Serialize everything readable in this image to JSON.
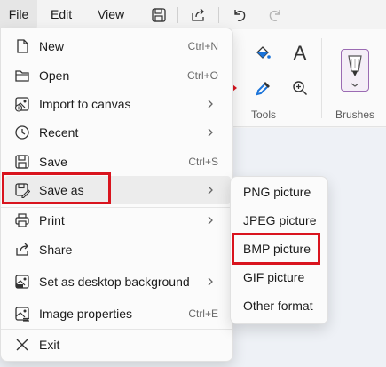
{
  "menubar": {
    "file": "File",
    "edit": "Edit",
    "view": "View"
  },
  "ribbon": {
    "tools_label": "Tools",
    "brushes_label": "Brushes",
    "text_tool_glyph": "A"
  },
  "file_menu": {
    "items": [
      {
        "label": "New",
        "shortcut": "Ctrl+N",
        "icon": "new-file-icon"
      },
      {
        "label": "Open",
        "shortcut": "Ctrl+O",
        "icon": "folder-icon"
      },
      {
        "label": "Import to canvas",
        "shortcut": "",
        "icon": "import-image-icon"
      },
      {
        "label": "Recent",
        "shortcut": "",
        "icon": "clock-icon"
      },
      {
        "label": "Save",
        "shortcut": "Ctrl+S",
        "icon": "save-icon"
      },
      {
        "label": "Save as",
        "shortcut": "",
        "icon": "save-as-icon"
      },
      {
        "label": "Print",
        "shortcut": "",
        "icon": "printer-icon"
      },
      {
        "label": "Share",
        "shortcut": "",
        "icon": "share-icon"
      },
      {
        "label": "Set as desktop background",
        "shortcut": "",
        "icon": "desktop-background-icon"
      },
      {
        "label": "Image properties",
        "shortcut": "Ctrl+E",
        "icon": "image-properties-icon"
      },
      {
        "label": "Exit",
        "shortcut": "",
        "icon": "close-icon"
      }
    ]
  },
  "save_as_submenu": {
    "items": [
      {
        "label": "PNG picture"
      },
      {
        "label": "JPEG picture"
      },
      {
        "label": "BMP picture"
      },
      {
        "label": "GIF picture"
      },
      {
        "label": "Other format"
      }
    ]
  },
  "colors": {
    "highlight": "#d9141e",
    "brush_accent": "#9b6bb3",
    "ribbon_accent": "#1a73d9"
  }
}
